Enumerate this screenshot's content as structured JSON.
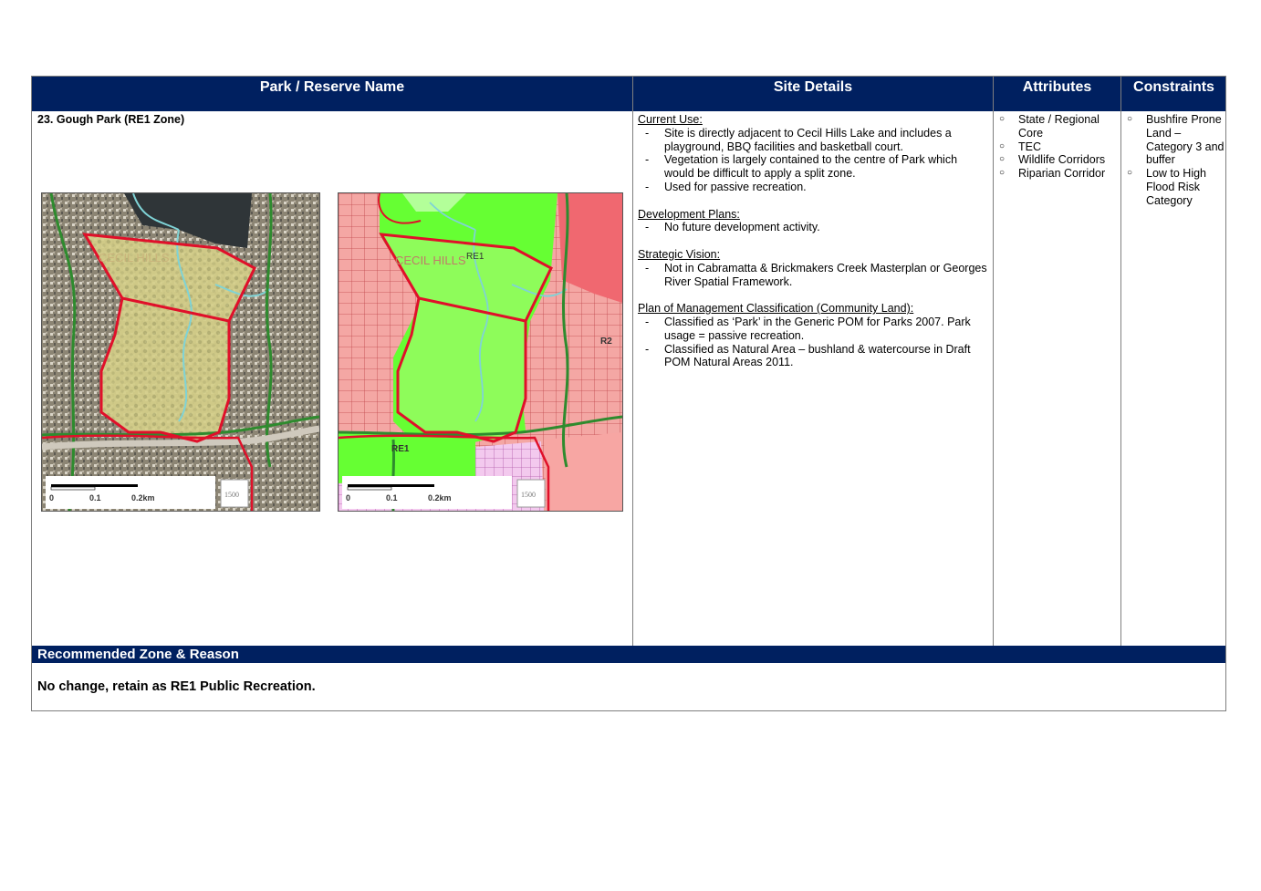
{
  "headers": {
    "park_name": "Park / Reserve Name",
    "site_details": "Site Details",
    "attributes": "Attributes",
    "constraints": "Constraints"
  },
  "park": {
    "title": "23. Gough Park (RE1 Zone)",
    "aerial_map": {
      "place_label": "CECIL HILLS",
      "scale_labels": [
        "0",
        "0.1",
        "0.2km"
      ],
      "scale_badge": "1500"
    },
    "zoning_map": {
      "place_label": "CECIL HILLS",
      "zone_labels": [
        "RE1",
        "R2",
        "RE1"
      ],
      "scale_labels": [
        "0",
        "0.1",
        "0.2km"
      ],
      "scale_badge": "1500"
    }
  },
  "site_details": {
    "current_use": {
      "heading": "Current Use:",
      "items": [
        "Site is directly adjacent to Cecil Hills Lake and includes a playground, BBQ facilities and basketball court.",
        "Vegetation is largely contained to the centre of Park which would be difficult to apply a split zone.",
        "Used for passive recreation."
      ]
    },
    "development_plans": {
      "heading": "Development Plans:",
      "items": [
        "No future development activity."
      ]
    },
    "strategic_vision": {
      "heading": "Strategic Vision:",
      "items": [
        "Not in Cabramatta & Brickmakers Creek Masterplan or Georges River Spatial Framework."
      ]
    },
    "plan_of_management": {
      "heading": "Plan of Management Classification (Community Land):",
      "items": [
        "Classified as ‘Park’ in the Generic POM for Parks 2007. Park usage = passive recreation.",
        "Classified as Natural Area – bushland & watercourse in Draft POM Natural Areas 2011."
      ]
    }
  },
  "attributes": [
    "State / Regional Core",
    "TEC",
    "Wildlife Corridors",
    "Riparian Corridor"
  ],
  "constraints": [
    "Bushfire Prone Land – Category 3 and buffer",
    "Low to High Flood Risk Category"
  ],
  "bullet_glyph": "○",
  "recommendation": {
    "heading": "Recommended Zone & Reason",
    "text": "No change, retain as RE1 Public Recreation."
  },
  "colors": {
    "header_bg": "#002060",
    "boundary": "#e0102a",
    "re1_green": "#66ff33",
    "residential_pink": "#f4a7a4"
  }
}
